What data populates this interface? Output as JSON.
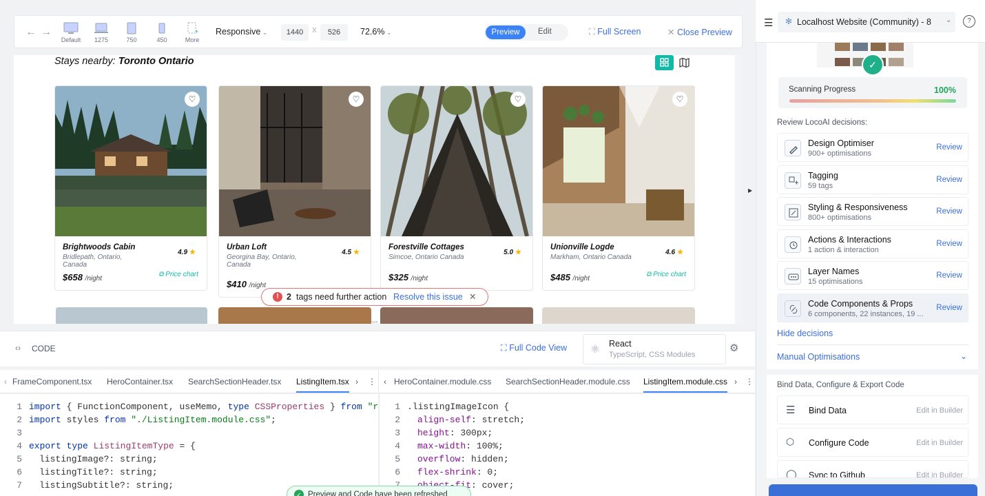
{
  "toolbar": {
    "devices": [
      "Default",
      "1275",
      "750",
      "450",
      "More"
    ],
    "responsive": "Responsive",
    "width": "1440",
    "times": "X",
    "height": "526",
    "zoom": "72.6%",
    "preview": "Preview",
    "edit": "Edit",
    "fullscreen": "Full Screen",
    "close_preview": "Close Preview"
  },
  "preview": {
    "heading_prefix": "Stays nearby:",
    "heading_place": "Toronto Ontario",
    "cards": [
      {
        "title": "Brightwoods Cabin",
        "subtitle": "Bridlepath, Ontario, Canada",
        "rating": "4.9",
        "price": "$658",
        "per": "/night",
        "chart": "Price chart"
      },
      {
        "title": "Urban Loft",
        "subtitle": "Georgina Bay, Ontario, Canada",
        "rating": "4.5",
        "price": "$410",
        "per": "/night",
        "chart": ""
      },
      {
        "title": "Forestville Cottages",
        "subtitle": "Simcoe, Ontario Canada",
        "rating": "5.0",
        "price": "$325",
        "per": "/night",
        "chart": ""
      },
      {
        "title": "Unionville Logde",
        "subtitle": "Markham, Ontario Canada",
        "rating": "4.6",
        "price": "$485",
        "per": "/night",
        "chart": "Price chart"
      }
    ],
    "toast_count": "2",
    "toast_text": "tags need further action",
    "toast_link": "Resolve this issue"
  },
  "code_header": {
    "label": "CODE",
    "full_code": "Full Code View",
    "framework": "React",
    "framework_sub": "TypeScript, CSS Modules"
  },
  "tabs_left": [
    "FrameComponent.tsx",
    "HeroContainer.tsx",
    "SearchSectionHeader.tsx",
    "ListingItem.tsx"
  ],
  "tabs_right": [
    "HeroContainer.module.css",
    "SearchSectionHeader.module.css",
    "ListingItem.module.css"
  ],
  "code_left": {
    "l1_import": "import",
    "l1_a": "{ FunctionComponent, useMemo,",
    "l1_type": "type",
    "l1_b": "CSSProperties",
    "l1_c": "}",
    "l1_from": "from",
    "l1_str": "\"react\"",
    "l2_import": "import",
    "l2_a": "styles",
    "l2_from": "from",
    "l2_str": "\"./ListingItem.module.css\"",
    "l2_end": ";",
    "l4_export": "export",
    "l4_type": "type",
    "l4_name": "ListingItemType",
    "l4_rest": " = {",
    "l5": "listingImage",
    "l5t": "?: string;",
    "l6": "listingTitle",
    "l6t": "?: string;",
    "l7": "listingSubtitle",
    "l7t": "?: string;"
  },
  "code_right": {
    "l1": ".listingImageIcon {",
    "l2p": "align-self",
    "l2v": ": stretch;",
    "l3p": "height",
    "l3v": ": 300px;",
    "l4p": "max-width",
    "l4v": ": 100%;",
    "l5p": "overflow",
    "l5v": ": hidden;",
    "l6p": "flex-shrink",
    "l6v": ": 0;",
    "l7p": "object-fit",
    "l7v": ": cover;"
  },
  "refreshed_toast": "Preview and Code have been refreshed",
  "right_panel": {
    "project": "Localhost Website (Community) - 8",
    "scan_label": "Scanning Progress",
    "scan_value": "100%",
    "scan_progress": 1.0,
    "review_heading": "Review LocoAI decisions:",
    "decisions": [
      {
        "title": "Design Optimiser",
        "sub": "900+ optimisations",
        "action": "Review"
      },
      {
        "title": "Tagging",
        "sub": "59 tags",
        "action": "Review"
      },
      {
        "title": "Styling & Responsiveness",
        "sub": "800+ optimisations",
        "action": "Review"
      },
      {
        "title": "Actions & Interactions",
        "sub": "1 action & interaction",
        "action": "Review"
      },
      {
        "title": "Layer Names",
        "sub": "15 optimisations",
        "action": "Review"
      },
      {
        "title": "Code Components & Props",
        "sub": "6 components, 22 instances, 19 ...",
        "action": "Review"
      }
    ],
    "hide": "Hide decisions",
    "manual": "Manual Optimisations",
    "bind_heading": "Bind Data, Configure & Export Code",
    "bind_items": [
      {
        "title": "Bind Data",
        "action": "Edit in Builder"
      },
      {
        "title": "Configure Code",
        "action": "Edit in Builder"
      },
      {
        "title": "Sync to Github",
        "action": "Edit in Builder"
      }
    ]
  },
  "colors": {
    "accent": "#3b82f6",
    "teal": "#14b8a6",
    "link": "#3b6fd8"
  }
}
